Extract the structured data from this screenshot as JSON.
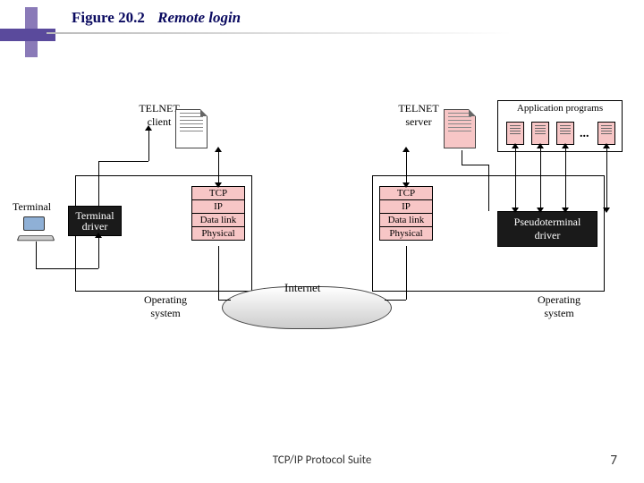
{
  "header": {
    "figure_number": "Figure 20.2",
    "figure_title": "Remote login"
  },
  "diagram": {
    "terminal_label": "Terminal",
    "client_label": "TELNET\nclient",
    "server_label": "TELNET\nserver",
    "apps_label": "Application programs",
    "terminal_driver": "Terminal\ndriver",
    "pseudoterminal_driver": "Pseudoterminal\ndriver",
    "os_label_left": "Operating\nsystem",
    "os_label_right": "Operating\nsystem",
    "internet_label": "Internet",
    "stack_left": [
      "TCP",
      "IP",
      "Data link",
      "Physical"
    ],
    "stack_right": [
      "TCP",
      "IP",
      "Data link",
      "Physical"
    ],
    "ellipsis": "..."
  },
  "footer": {
    "text": "TCP/IP Protocol Suite",
    "page": "7"
  }
}
